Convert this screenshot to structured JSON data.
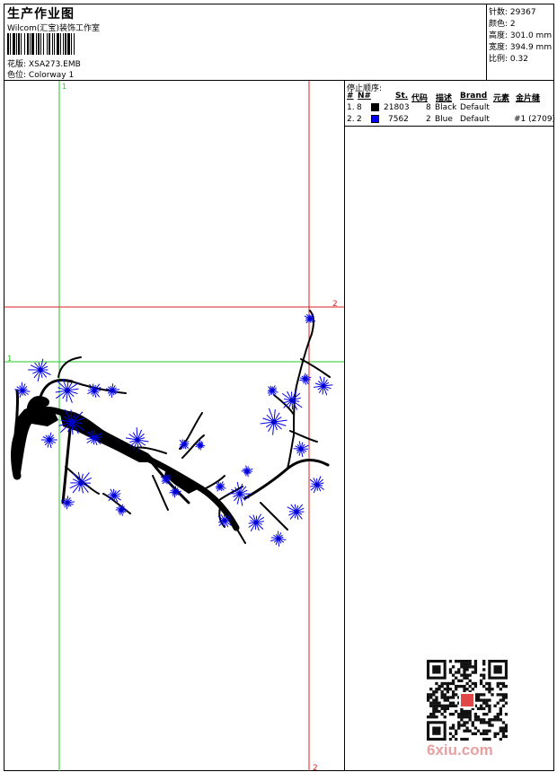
{
  "header": {
    "title": "生产作业图",
    "company": "Wilcom(汇宝)装饰工作室",
    "design_label": "花版:",
    "design_value": "XSA273.EMB",
    "colorway_label": "色位:",
    "colorway_value": "Colorway 1"
  },
  "stats": [
    {
      "label": "针数:",
      "value": "29367"
    },
    {
      "label": "颜色:",
      "value": "2"
    },
    {
      "label": "高度:",
      "value": "301.0 mm"
    },
    {
      "label": "宽度:",
      "value": "394.9 mm"
    },
    {
      "label": "比例:",
      "value": "0.32"
    }
  ],
  "stop_sequence": {
    "title": "停止顺序:",
    "columns": [
      "#",
      "N#",
      "St.",
      "代码",
      "描述",
      "Brand",
      "元素",
      "金片缝"
    ],
    "rows": [
      {
        "num": "1.",
        "n": "8",
        "color": "#000000",
        "stitches": "21803",
        "code": "8",
        "desc": "Black",
        "brand": "Default",
        "element": "",
        "sequin": ""
      },
      {
        "num": "2.",
        "n": "2",
        "color": "#0000ee",
        "stitches": "7562",
        "code": "2",
        "desc": "Blue",
        "brand": "Default",
        "element": "",
        "sequin": "#1 (2709)"
      }
    ]
  },
  "guides": {
    "green_label_top": "1",
    "green_label_left": "1",
    "red_label_right": "2",
    "red_label_bottom": "2",
    "green_color": "#22cc22",
    "red_color": "#dd2222"
  },
  "watermark": "6xiu.com"
}
